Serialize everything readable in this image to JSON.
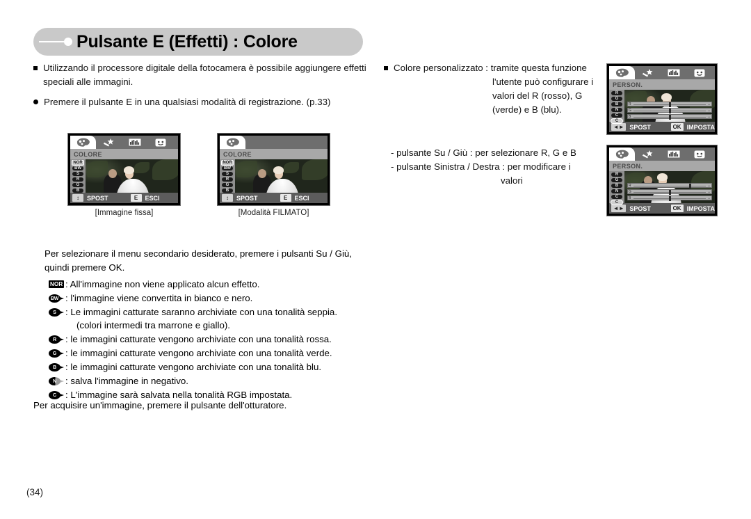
{
  "header": {
    "title": "Pulsante E (Effetti) : Colore"
  },
  "left_intro": {
    "bullet1_line1": "Utilizzando il processore digitale della fotocamera è possibile aggiungere effetti",
    "bullet1_line2": "speciali alle immagini.",
    "bullet2": "Premere il pulsante E in una qualsiasi modalità di registrazione. (p.33)"
  },
  "right_intro": {
    "bullet_line1": "Colore personalizzato : tramite questa funzione",
    "bullet_line2": "l'utente può configurare i",
    "bullet_line3": "valori del R (rosso), G",
    "bullet_line4": "(verde) e B (blu).",
    "sub_line1": "- pulsante Su / Giù : per selezionare R, G e B",
    "sub_line2": "- pulsante Sinistra / Destra : per modificare i",
    "sub_line3": "valori"
  },
  "lcd_still": {
    "menu_title": "COLORE",
    "tabs": [
      "palette-tab",
      "effects-tab",
      "histogram-tab",
      "face-tab"
    ],
    "active_tab": 0,
    "icons": [
      "NOR",
      "BW",
      "S",
      "R",
      "G",
      "B"
    ],
    "selected_icon": 0,
    "status": {
      "move_key": "↕",
      "move_label": "SPOST",
      "exit_key": "E",
      "exit_label": "ESCI"
    },
    "caption": "[Immagine fissa]"
  },
  "lcd_movie": {
    "menu_title": "COLORE",
    "tabs": [
      "palette-tab"
    ],
    "active_tab": 0,
    "icons": [
      "NOR",
      "BW",
      "S",
      "R",
      "G",
      "B"
    ],
    "selected_icon": 0,
    "status": {
      "move_key": "↕",
      "move_label": "SPOST",
      "exit_key": "E",
      "exit_label": "ESCI"
    },
    "caption": "[Modalità FILMATO]"
  },
  "lcd_custom_top": {
    "menu_title": "PERSON.",
    "tabs": [
      "palette-tab",
      "effects-tab",
      "histogram-tab",
      "face-tab"
    ],
    "active_tab": 0,
    "icons": [
      "R",
      "G",
      "B",
      "N",
      "C",
      "C"
    ],
    "selected_icon": 5,
    "sliders": [
      {
        "label": "R",
        "value": 50,
        "arrow": "↔"
      },
      {
        "label": "G",
        "value": 50,
        "arrow": "↔"
      },
      {
        "label": "B",
        "value": 50,
        "arrow": "↔"
      }
    ],
    "status": {
      "move_key": "◄►",
      "move_label": "SPOST",
      "set_key": "OK",
      "set_label": "IMPOSTA"
    }
  },
  "lcd_custom_bottom": {
    "menu_title": "PERSON.",
    "tabs": [
      "palette-tab",
      "effects-tab",
      "histogram-tab",
      "face-tab"
    ],
    "active_tab": 0,
    "icons": [
      "R",
      "G",
      "B",
      "N",
      "C",
      "C"
    ],
    "selected_icon": 5,
    "sliders": [
      {
        "label": "R",
        "value": 75,
        "arrow": "↔"
      },
      {
        "label": "G",
        "value": 50,
        "arrow": "↔"
      },
      {
        "label": "B",
        "value": 50,
        "arrow": "↔"
      }
    ],
    "status": {
      "move_key": "◄►",
      "move_label": "SPOST",
      "set_key": "OK",
      "set_label": "IMPOSTA"
    }
  },
  "lower": {
    "lead_line1": "Per selezionare il menu secondario desiderato, premere i pulsanti Su / Giù,",
    "lead_line2": "quindi premere OK.",
    "items": [
      {
        "glyph": "NOR",
        "glyph_kind": "square",
        "text": ": All'immagine non viene applicato alcun effetto.",
        "cont": ""
      },
      {
        "glyph": "BW",
        "glyph_kind": "oval",
        "text": ": l'immagine viene convertita in bianco e nero.",
        "cont": ""
      },
      {
        "glyph": "S",
        "glyph_kind": "oval",
        "text": ": Le immagini catturate saranno archiviate con una tonalità seppia.",
        "cont": "(colori intermedi tra marrone e giallo)."
      },
      {
        "glyph": "R",
        "glyph_kind": "oval",
        "text": ": le immagini catturate vengono archiviate con una tonalità rossa.",
        "cont": ""
      },
      {
        "glyph": "G",
        "glyph_kind": "oval",
        "text": ": le immagini catturate vengono archiviate con una tonalità verde.",
        "cont": ""
      },
      {
        "glyph": "B",
        "glyph_kind": "oval",
        "text": ": le immagini catturate vengono archiviate con una tonalità blu.",
        "cont": ""
      },
      {
        "glyph": "N",
        "glyph_kind": "oval-half",
        "text": ": salva l'immagine in negativo.",
        "cont": ""
      },
      {
        "glyph": "C",
        "glyph_kind": "oval",
        "text": ": L'immagine sarà salvata nella tonalità RGB impostata.",
        "cont": ""
      }
    ]
  },
  "closing": "Per acquisire un'immagine, premere il pulsante dell'otturatore.",
  "page_number": "(34)"
}
